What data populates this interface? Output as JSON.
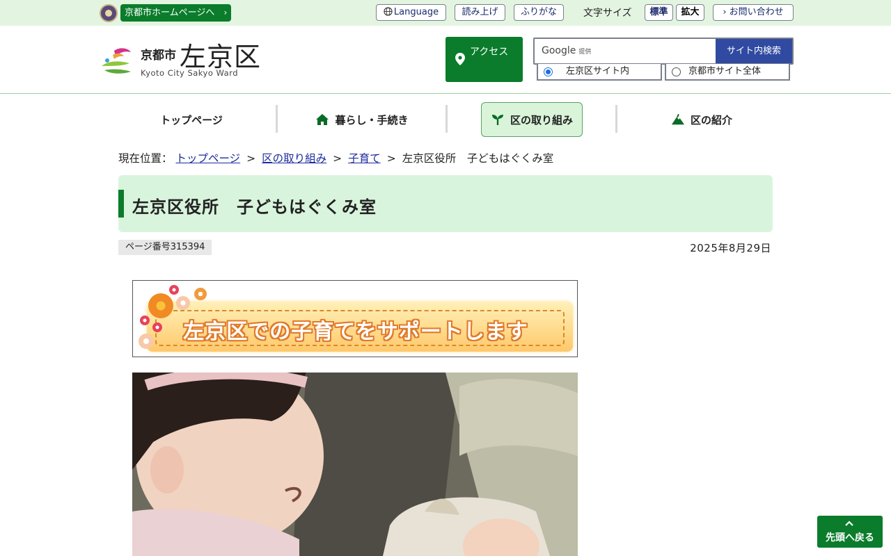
{
  "topbar": {
    "city_link": "京都市ホームページへ",
    "language": "Language",
    "read_aloud": "読み上げ",
    "furigana": "ふりがな",
    "font_size_label": "文字サイズ",
    "font_standard": "標準",
    "font_large": "拡大",
    "contact": "お問い合わせ"
  },
  "header": {
    "logo_city": "京都市",
    "logo_ward": "左京区",
    "logo_en": "Kyoto City Sakyo Ward",
    "access": "アクセス",
    "search": {
      "google": "Google",
      "provided": "提供",
      "button": "サイト内検索",
      "scope_ward": "左京区サイト内",
      "scope_city": "京都市サイト全体"
    }
  },
  "nav": {
    "items": [
      {
        "label": "トップページ"
      },
      {
        "label": "暮らし・手続き"
      },
      {
        "label": "区の取り組み"
      },
      {
        "label": "区の紹介"
      }
    ]
  },
  "breadcrumb": {
    "prefix": "現在位置：",
    "items": [
      "トップページ",
      "区の取り組み",
      "子育て"
    ],
    "current": "左京区役所　子どもはぐくみ室"
  },
  "page": {
    "title": "左京区役所　子どもはぐくみ室",
    "page_number": "ページ番号315394",
    "date": "2025年8月29日",
    "banner_text": "左京区での子育てをサポートします"
  },
  "back_to_top": "先頭へ戻る",
  "colors": {
    "brand_green": "#0a7c2b",
    "title_bg": "#d9f4dd",
    "topbar_bg": "#e3f5e1",
    "search_button": "#2f4aa0",
    "link": "#1a2a9c"
  }
}
